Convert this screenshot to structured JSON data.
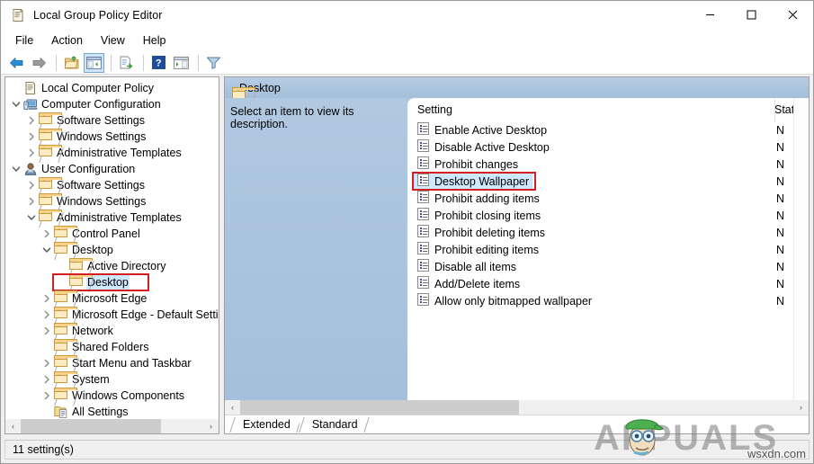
{
  "window": {
    "title": "Local Group Policy Editor",
    "title_icon": "policy-document-icon",
    "minimize_label": "—",
    "maximize_label": "□",
    "close_label": "✕"
  },
  "menubar": {
    "items": [
      {
        "label": "File",
        "name": "menu-file"
      },
      {
        "label": "Action",
        "name": "menu-action"
      },
      {
        "label": "View",
        "name": "menu-view"
      },
      {
        "label": "Help",
        "name": "menu-help"
      }
    ]
  },
  "toolbar": {
    "buttons": [
      {
        "name": "back-icon",
        "icon": "arrow-left",
        "active": false
      },
      {
        "name": "forward-icon",
        "icon": "arrow-right",
        "active": false
      },
      {
        "name": "up-one-level-icon",
        "icon": "folder-up",
        "active": false
      },
      {
        "name": "show-hide-console-tree-icon",
        "icon": "console-tree",
        "active": true
      },
      {
        "name": "export-list-icon",
        "icon": "export-list",
        "active": false
      },
      {
        "name": "help-icon",
        "icon": "question-mark",
        "active": false
      },
      {
        "name": "show-hide-action-pane-icon",
        "icon": "action-pane",
        "active": false
      },
      {
        "name": "filter-icon",
        "icon": "funnel",
        "active": false
      }
    ]
  },
  "tree": {
    "nodes": [
      {
        "label": "Local Computer Policy",
        "indent": 0,
        "twist": "none",
        "icon": "policy-document-icon",
        "selected": false
      },
      {
        "label": "Computer Configuration",
        "indent": 0,
        "twist": "open",
        "icon": "computer-icon",
        "selected": false
      },
      {
        "label": "Software Settings",
        "indent": 1,
        "twist": "closed",
        "icon": "folder-icon",
        "selected": false
      },
      {
        "label": "Windows Settings",
        "indent": 1,
        "twist": "closed",
        "icon": "folder-icon",
        "selected": false
      },
      {
        "label": "Administrative Templates",
        "indent": 1,
        "twist": "closed",
        "icon": "folder-icon",
        "selected": false
      },
      {
        "label": "User Configuration",
        "indent": 0,
        "twist": "open",
        "icon": "user-icon",
        "selected": false
      },
      {
        "label": "Software Settings",
        "indent": 1,
        "twist": "closed",
        "icon": "folder-icon",
        "selected": false
      },
      {
        "label": "Windows Settings",
        "indent": 1,
        "twist": "closed",
        "icon": "folder-icon",
        "selected": false
      },
      {
        "label": "Administrative Templates",
        "indent": 1,
        "twist": "open",
        "icon": "folder-icon",
        "selected": false
      },
      {
        "label": "Control Panel",
        "indent": 2,
        "twist": "closed",
        "icon": "folder-icon",
        "selected": false
      },
      {
        "label": "Desktop",
        "indent": 2,
        "twist": "open",
        "icon": "folder-icon",
        "selected": false
      },
      {
        "label": "Active Directory",
        "indent": 3,
        "twist": "none",
        "icon": "folder-icon",
        "selected": false
      },
      {
        "label": "Desktop",
        "indent": 3,
        "twist": "none",
        "icon": "folder-icon",
        "selected": true
      },
      {
        "label": "Microsoft Edge",
        "indent": 2,
        "twist": "closed",
        "icon": "folder-icon",
        "selected": false
      },
      {
        "label": "Microsoft Edge - Default Settin",
        "indent": 2,
        "twist": "closed",
        "icon": "folder-icon",
        "selected": false
      },
      {
        "label": "Network",
        "indent": 2,
        "twist": "closed",
        "icon": "folder-icon",
        "selected": false
      },
      {
        "label": "Shared Folders",
        "indent": 2,
        "twist": "none",
        "icon": "folder-icon",
        "selected": false
      },
      {
        "label": "Start Menu and Taskbar",
        "indent": 2,
        "twist": "closed",
        "icon": "folder-icon",
        "selected": false
      },
      {
        "label": "System",
        "indent": 2,
        "twist": "closed",
        "icon": "folder-icon",
        "selected": false
      },
      {
        "label": "Windows Components",
        "indent": 2,
        "twist": "closed",
        "icon": "folder-icon",
        "selected": false
      },
      {
        "label": "All Settings",
        "indent": 2,
        "twist": "none",
        "icon": "all-settings-icon",
        "selected": false
      }
    ],
    "hscroll": {
      "left_arrow": "‹",
      "right_arrow": "›"
    }
  },
  "content": {
    "header_title": "Desktop",
    "header_icon": "folder-icon",
    "description": "Select an item to view its description.",
    "columns": {
      "setting": "Setting",
      "state": "State"
    },
    "rows": [
      {
        "setting": "Enable Active Desktop",
        "state": "N",
        "selected": false
      },
      {
        "setting": "Disable Active Desktop",
        "state": "N",
        "selected": false
      },
      {
        "setting": "Prohibit changes",
        "state": "N",
        "selected": false
      },
      {
        "setting": "Desktop Wallpaper",
        "state": "N",
        "selected": true
      },
      {
        "setting": "Prohibit adding items",
        "state": "N",
        "selected": false
      },
      {
        "setting": "Prohibit closing items",
        "state": "N",
        "selected": false
      },
      {
        "setting": "Prohibit deleting items",
        "state": "N",
        "selected": false
      },
      {
        "setting": "Prohibit editing items",
        "state": "N",
        "selected": false
      },
      {
        "setting": "Disable all items",
        "state": "N",
        "selected": false
      },
      {
        "setting": "Add/Delete items",
        "state": "N",
        "selected": false
      },
      {
        "setting": "Allow only bitmapped wallpaper",
        "state": "N",
        "selected": false
      }
    ],
    "hscroll": {
      "left_arrow": "‹",
      "right_arrow": "›"
    },
    "tabs": [
      {
        "label": "Extended",
        "name": "tab-extended",
        "active": false
      },
      {
        "label": "Standard",
        "name": "tab-standard",
        "active": true
      }
    ]
  },
  "statusbar": {
    "text": "11 setting(s)"
  },
  "watermark": {
    "brand": "APPUALS",
    "site": "wsxdn.com"
  },
  "colors": {
    "selection_blue": "#cde8ff",
    "highlight_red": "#d31f1f",
    "header_blue": "#a9c4e0",
    "folder_yellow": "#fbd48a"
  }
}
